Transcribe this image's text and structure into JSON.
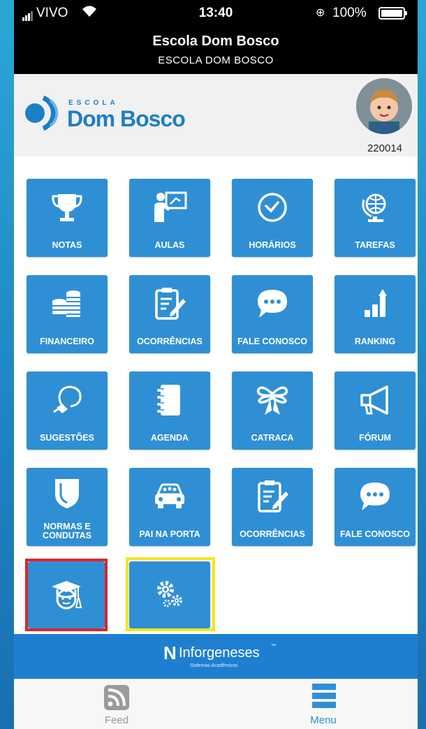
{
  "status_bar": {
    "carrier": "VIVO",
    "time": "13:40",
    "battery": "100%"
  },
  "title_bar": {
    "title": "Escola Dom Bosco",
    "subtitle": "ESCOLA DOM BOSCO"
  },
  "header": {
    "logo_small": "ESCOLA",
    "logo_big": "Dom Bosco",
    "user_id": "220014"
  },
  "menu": {
    "items": [
      {
        "label": "NOTAS",
        "icon": "trophy-icon"
      },
      {
        "label": "AULAS",
        "icon": "teacher-board-icon"
      },
      {
        "label": "HORÁRIOS",
        "icon": "clock-icon"
      },
      {
        "label": "TAREFAS",
        "icon": "globe-icon"
      },
      {
        "label": "FINANCEIRO",
        "icon": "coins-icon"
      },
      {
        "label": "OCORRÊNCIAS",
        "icon": "clipboard-edit-icon"
      },
      {
        "label": "FALE CONOSCO",
        "icon": "chat-bubble-icon"
      },
      {
        "label": "RANKING",
        "icon": "ranking-chart-icon"
      },
      {
        "label": "SUGESTÕES",
        "icon": "lightbulb-icon"
      },
      {
        "label": "AGENDA",
        "icon": "notebook-icon"
      },
      {
        "label": "CATRACA",
        "icon": "ribbon-icon"
      },
      {
        "label": "FÓRUM",
        "icon": "megaphone-icon"
      },
      {
        "label": "NORMAS E CONDUTAS",
        "icon": "shield-icon"
      },
      {
        "label": "PAI NA PORTA",
        "icon": "car-family-icon"
      },
      {
        "label": "OCORRÊNCIAS",
        "icon": "clipboard-edit-icon"
      },
      {
        "label": "FALE CONOSCO",
        "icon": "chat-bubble-icon"
      },
      {
        "label": "",
        "icon": "graduate-icon"
      },
      {
        "label": "",
        "icon": "gears-icon"
      }
    ]
  },
  "brand": {
    "name": "Inforgeneses",
    "tagline": "Sistemas Acadêmicos"
  },
  "tabs": {
    "feed": "Feed",
    "menu": "Menu"
  },
  "colors": {
    "tile": "#2f8fd5",
    "brand_bar": "#1e7fd0",
    "highlight_red": "#d8262c",
    "highlight_yellow": "#f5e61d"
  }
}
